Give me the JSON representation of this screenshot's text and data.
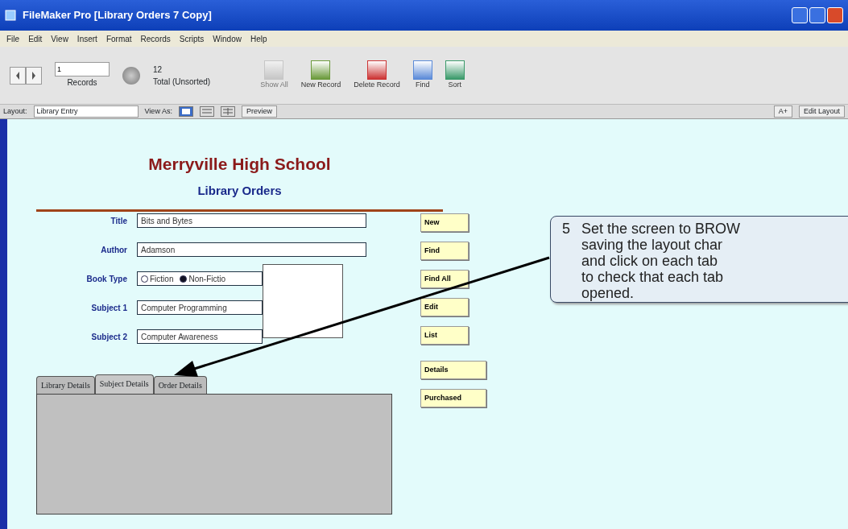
{
  "window": {
    "title": "FileMaker Pro  [Library Orders 7 Copy]"
  },
  "menu": [
    "File",
    "Edit",
    "View",
    "Insert",
    "Format",
    "Records",
    "Scripts",
    "Window",
    "Help"
  ],
  "toolbar": {
    "record_number": "1",
    "records_label": "Records",
    "total": "12",
    "total_label": "Total (Unsorted)",
    "buttons": [
      {
        "label": "Show All",
        "disabled": true,
        "kind": "showall"
      },
      {
        "label": "New Record",
        "disabled": false,
        "kind": "new"
      },
      {
        "label": "Delete Record",
        "disabled": false,
        "kind": "delete"
      },
      {
        "label": "Find",
        "disabled": false,
        "kind": "find"
      },
      {
        "label": "Sort",
        "disabled": false,
        "kind": "sort"
      }
    ]
  },
  "layout_bar": {
    "layout_label": "Layout:",
    "layout": "Library Entry",
    "view_as_label": "View As:",
    "views": [
      {
        "kind": "form",
        "selected": true
      },
      {
        "kind": "list",
        "selected": false
      },
      {
        "kind": "table",
        "selected": false
      }
    ],
    "preview": "Preview",
    "font_button": "A+",
    "edit_layout": "Edit Layout"
  },
  "form": {
    "heading": "Merryville High School",
    "subheading": "Library Orders",
    "fields": [
      {
        "label": "Title",
        "value": "Bits and Bytes",
        "kind": "wide"
      },
      {
        "label": "Author",
        "value": "Adamson",
        "kind": "wide"
      },
      {
        "label": "Book Type",
        "kind": "radio",
        "options": [
          {
            "label": "Fiction",
            "selected": false
          },
          {
            "label": "Non-Fictio",
            "selected": true
          }
        ]
      },
      {
        "label": "Subject 1",
        "value": "Computer Programming",
        "kind": "narrow"
      },
      {
        "label": "Subject 2",
        "value": "Computer Awareness",
        "kind": "narrow"
      }
    ],
    "side_buttons": [
      {
        "label": "New",
        "kind": "small"
      },
      {
        "label": "Find",
        "kind": "small"
      },
      {
        "label": "Find All",
        "kind": "small"
      },
      {
        "label": "Edit",
        "kind": "small"
      },
      {
        "label": "List",
        "kind": "small"
      },
      {
        "label": "Details",
        "kind": "large"
      },
      {
        "label": "Purchased",
        "kind": "large"
      }
    ],
    "tabs": [
      {
        "label": "Library Details",
        "selected": false
      },
      {
        "label": "Subject Details",
        "selected": true
      },
      {
        "label": "Order Details",
        "selected": false
      }
    ]
  },
  "callout": {
    "number": "5",
    "lines": [
      "Set the screen to BROW",
      "saving the layout char",
      "and click on each tab",
      "to check that each tab",
      "opened."
    ]
  }
}
